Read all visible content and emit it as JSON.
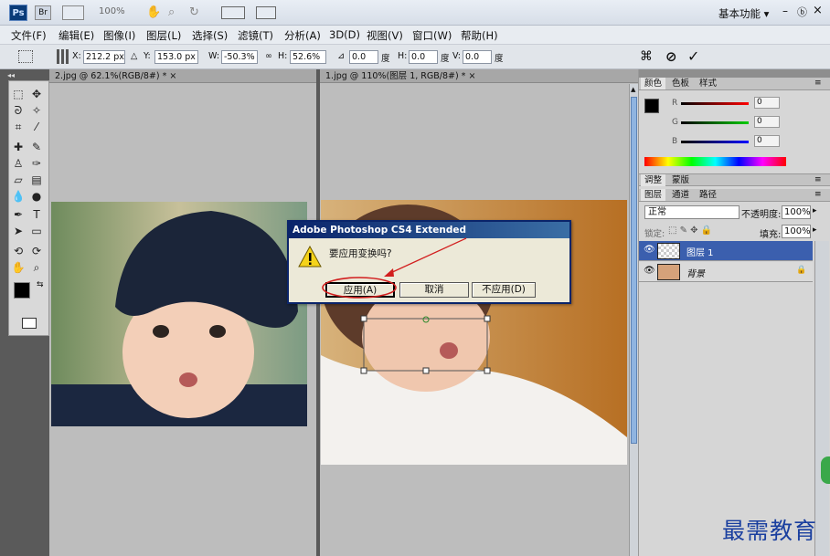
{
  "titlebar": {
    "logo": "Ps",
    "zoom": "100%",
    "workspace": "基本功能 ▾",
    "min": "–",
    "restore": "ⓑ",
    "close": "×"
  },
  "menu": [
    "文件(F)",
    "编辑(E)",
    "图像(I)",
    "图层(L)",
    "选择(S)",
    "滤镜(T)",
    "分析(A)",
    "3D(D)",
    "视图(V)",
    "窗口(W)",
    "帮助(H)"
  ],
  "options": {
    "x_label": "X:",
    "x_value": "212.2 px",
    "y_label": "Y:",
    "y_value": "153.0 px",
    "w_label": "W:",
    "w_value": "-50.3%",
    "h_label": "H:",
    "h_value": "52.6%",
    "angle_value": "0.0",
    "angle_unit": "度",
    "hskew_label": "H:",
    "hskew_value": "0.0",
    "hskew_unit": "度",
    "vskew_label": "V:",
    "vskew_value": "0.0",
    "vskew_unit": "度"
  },
  "documents": {
    "doc1_tab": "2.jpg @ 62.1%(RGB/8#) * ×",
    "doc2_tab": "1.jpg @ 110%(图层 1, RGB/8#) * ×"
  },
  "panels": {
    "color_tabs": [
      "颜色",
      "色板",
      "样式"
    ],
    "adjust_tabs": [
      "调整",
      "蒙版"
    ],
    "layer_tabs": [
      "图层",
      "通道",
      "路径"
    ],
    "blend_mode": "正常",
    "opacity_label": "不透明度:",
    "opacity_value": "100%",
    "lock_label": "锁定:",
    "fill_label": "填充:",
    "fill_value": "100%",
    "layers": [
      {
        "name": "图层 1"
      },
      {
        "name": "背景"
      }
    ],
    "r_label": "R",
    "g_label": "G",
    "b_label": "B",
    "r_value": "0",
    "g_value": "0",
    "b_value": "0"
  },
  "dialog": {
    "title": "Adobe Photoshop CS4 Extended",
    "message": "要应用变换吗?",
    "apply": "应用(A)",
    "cancel": "取消",
    "dont_apply": "不应用(D)"
  },
  "watermark": "最需教育",
  "colors": {
    "accent": "#0a246a",
    "highlight_layer": "#3b5fae",
    "annotation": "#d21e1e"
  }
}
